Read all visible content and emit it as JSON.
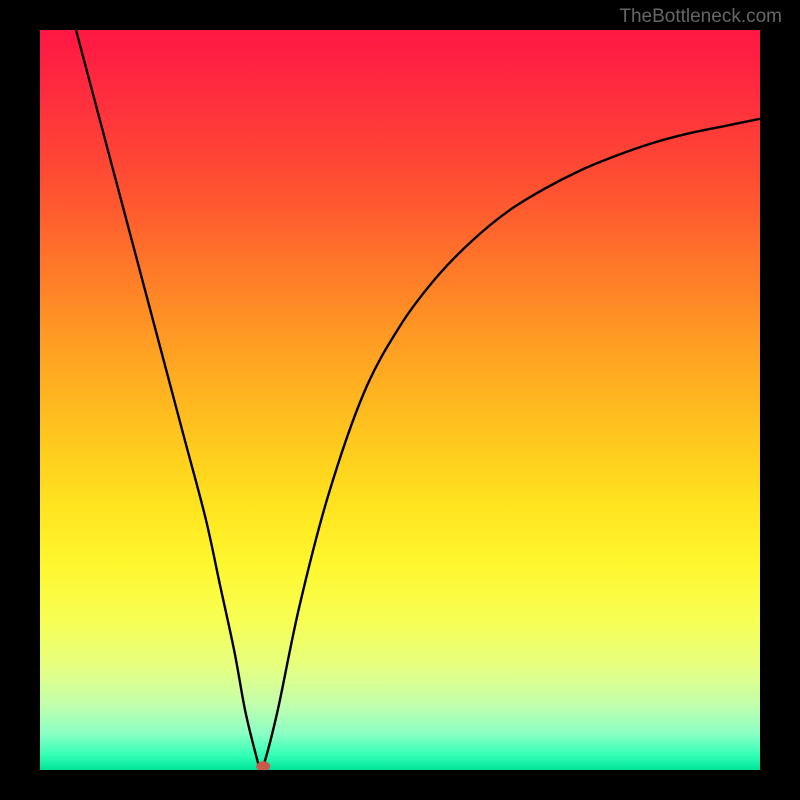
{
  "watermark": "TheBottleneck.com",
  "chart_data": {
    "type": "line",
    "title": "",
    "xlabel": "",
    "ylabel": "",
    "xlim": [
      0,
      100
    ],
    "ylim": [
      0,
      100
    ],
    "series": [
      {
        "name": "curve",
        "x": [
          5,
          8,
          11,
          14,
          17,
          20,
          23,
          25,
          27,
          28.5,
          30,
          30.5,
          31,
          33,
          36,
          40,
          45,
          50,
          55,
          60,
          65,
          70,
          75,
          80,
          85,
          90,
          95,
          100
        ],
        "y": [
          100,
          89,
          78,
          67,
          56,
          45,
          34,
          25,
          16,
          8,
          2,
          0.5,
          0.5,
          8,
          22,
          37,
          51,
          60,
          66.5,
          71.5,
          75.5,
          78.5,
          81,
          83,
          84.7,
          86,
          87,
          88
        ]
      }
    ],
    "marker": {
      "x": 31,
      "y": 0.5
    },
    "gradient": {
      "stops": [
        {
          "offset": 0.0,
          "color": "#ff1744"
        },
        {
          "offset": 0.08,
          "color": "#ff2b3f"
        },
        {
          "offset": 0.16,
          "color": "#ff4136"
        },
        {
          "offset": 0.24,
          "color": "#ff5a2f"
        },
        {
          "offset": 0.32,
          "color": "#ff7829"
        },
        {
          "offset": 0.4,
          "color": "#ff9524"
        },
        {
          "offset": 0.48,
          "color": "#ffb020"
        },
        {
          "offset": 0.56,
          "color": "#ffca1e"
        },
        {
          "offset": 0.64,
          "color": "#ffe31f"
        },
        {
          "offset": 0.72,
          "color": "#fff72d"
        },
        {
          "offset": 0.8,
          "color": "#f7ff55"
        },
        {
          "offset": 0.86,
          "color": "#e6ff80"
        },
        {
          "offset": 0.91,
          "color": "#c4ffab"
        },
        {
          "offset": 0.95,
          "color": "#8cffc4"
        },
        {
          "offset": 0.98,
          "color": "#32ffb5"
        },
        {
          "offset": 1.0,
          "color": "#00e39a"
        }
      ]
    }
  }
}
